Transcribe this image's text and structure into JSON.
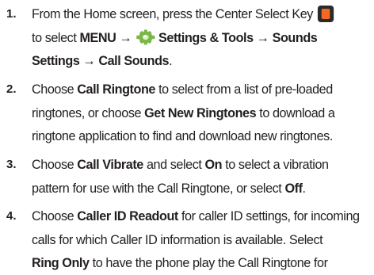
{
  "steps": [
    {
      "number": "1.",
      "line1": "From the Home screen, press the Center Select Key",
      "line2_pre": "to select ",
      "menu": "MENU",
      "arrow": "→",
      "settings_tools": "Settings & Tools",
      "sounds_settings": "Sounds",
      "line3_settings": "Settings",
      "call_sounds": "Call Sounds",
      "line3_end": "."
    },
    {
      "number": "2.",
      "l1_pre": "Choose ",
      "call_ringtone": "Call Ringtone",
      "l1_post": " to select from a list of pre-loaded",
      "l2_pre": "ringtones, or choose ",
      "get_new_ringtones": "Get New Ringtones",
      "l2_post": " to download a",
      "l3": "ringtone application to find and download new ringtones."
    },
    {
      "number": "3.",
      "l1_pre": "Choose ",
      "call_vibrate": "Call Vibrate",
      "l1_mid": " and select ",
      "on": "On",
      "l1_post": " to select a vibration",
      "l2_pre": "pattern for use with the Call Ringtone, or select ",
      "off": "Off",
      "l2_post": "."
    },
    {
      "number": "4.",
      "l1_pre": "Choose ",
      "caller_id_readout": "Caller ID Readout",
      "l1_post": " for caller ID settings, for incoming",
      "l2": "calls for which Caller ID information is available. Select",
      "ring_only": "Ring Only",
      "l3_post": " to have the phone play the Call Ringtone for"
    }
  ],
  "icons": {
    "center_select_key": "center-select-key-icon",
    "settings_tools": "gear-icon"
  },
  "colors": {
    "text": "#231f20",
    "key_accent": "#f26a21",
    "gear_green": "#7ab648"
  }
}
